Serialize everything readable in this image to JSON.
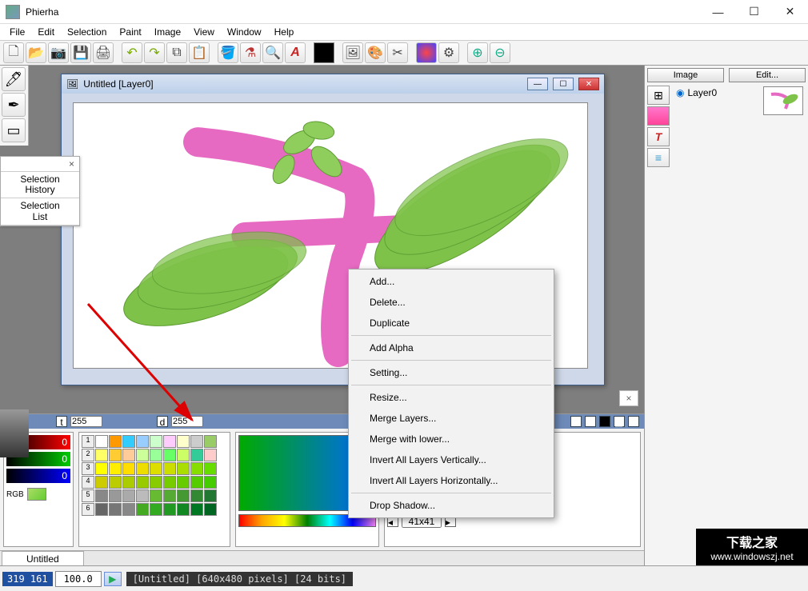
{
  "app": {
    "title": "Phierha"
  },
  "menu": {
    "items": [
      "File",
      "Edit",
      "Selection",
      "Paint",
      "Image",
      "View",
      "Window",
      "Help"
    ]
  },
  "selection_panel": {
    "history": "Selection\nHistory",
    "list": "Selection\nList"
  },
  "doc": {
    "title": "Untitled  [Layer0]"
  },
  "context_menu": {
    "items": [
      "Add...",
      "Delete...",
      "Duplicate",
      "-",
      "Add Alpha",
      "-",
      "Setting...",
      "-",
      "Resize...",
      "Merge Layers...",
      "Merge with lower...",
      "Invert All Layers Vertically...",
      "Invert All Layers Horizontally...",
      "-",
      "Drop Shadow..."
    ]
  },
  "right": {
    "btn_image": "Image",
    "btn_edit": "Edit...",
    "layer0": "Layer0"
  },
  "rgb": {
    "r": "0",
    "g": "0",
    "b": "0",
    "label": "RGB"
  },
  "opacity": {
    "t": "t",
    "t_val": "255",
    "d": "d",
    "d_val": "255"
  },
  "brush": {
    "size": "41x41"
  },
  "status": {
    "coord": "319 161",
    "zoom": "100.0",
    "info": "[Untitled] [640x480 pixels] [24 bits]",
    "tab": "Untitled"
  },
  "watermark": {
    "line1": "下载之家",
    "line2": "www.windowszj.net"
  },
  "swatch_rows": [
    "1",
    "2",
    "3",
    "4",
    "5",
    "6"
  ]
}
